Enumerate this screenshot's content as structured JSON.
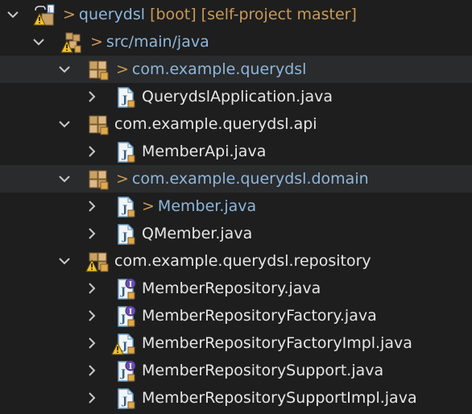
{
  "colors": {
    "background": "#1e1e1e",
    "selected_row": "#2a2b2c",
    "text": "#e6e6e6",
    "changed_text": "#8db7dd",
    "git_decoration": "#c99a57",
    "package_icon": "#c8a165",
    "java_file_icon": "#6da2c9",
    "interface_badge": "#6a4fb4",
    "warning": "#f1c232"
  },
  "tree": {
    "project": {
      "icon": "project-icon-with-warning",
      "prefix": ">",
      "name": "querydsl",
      "decoration": "[boot] [self-project master]"
    },
    "source_folder": {
      "icon": "source-folder-icon-with-warning",
      "prefix": ">",
      "name": "src/main/java"
    },
    "items": [
      {
        "kind": "package",
        "icon": "package-icon",
        "prefix": ">",
        "label": "com.example.querydsl",
        "changed": true,
        "expanded": true
      },
      {
        "kind": "file",
        "icon": "java-class-icon",
        "prefix": "",
        "label": "QuerydslApplication.java",
        "changed": false,
        "expanded": false
      },
      {
        "kind": "package",
        "icon": "package-icon",
        "prefix": "",
        "label": "com.example.querydsl.api",
        "changed": false,
        "expanded": true
      },
      {
        "kind": "file",
        "icon": "java-class-icon",
        "prefix": "",
        "label": "MemberApi.java",
        "changed": false,
        "expanded": false
      },
      {
        "kind": "package",
        "icon": "package-icon",
        "prefix": ">",
        "label": "com.example.querydsl.domain",
        "changed": true,
        "expanded": true
      },
      {
        "kind": "file",
        "icon": "java-class-icon",
        "prefix": ">",
        "label": "Member.java",
        "changed": true,
        "expanded": false
      },
      {
        "kind": "file",
        "icon": "java-class-icon",
        "prefix": "",
        "label": "QMember.java",
        "changed": false,
        "expanded": false
      },
      {
        "kind": "package",
        "icon": "package-icon-with-warning",
        "prefix": "",
        "label": "com.example.querydsl.repository",
        "changed": false,
        "expanded": true
      },
      {
        "kind": "file",
        "icon": "java-interface-icon",
        "prefix": "",
        "label": "MemberRepository.java",
        "changed": false,
        "expanded": false
      },
      {
        "kind": "file",
        "icon": "java-interface-icon",
        "prefix": "",
        "label": "MemberRepositoryFactory.java",
        "changed": false,
        "expanded": false
      },
      {
        "kind": "file",
        "icon": "java-class-icon-with-warning",
        "prefix": "",
        "label": "MemberRepositoryFactoryImpl.java",
        "changed": false,
        "expanded": false
      },
      {
        "kind": "file",
        "icon": "java-interface-icon",
        "prefix": "",
        "label": "MemberRepositorySupport.java",
        "changed": false,
        "expanded": false
      },
      {
        "kind": "file",
        "icon": "java-class-icon",
        "prefix": "",
        "label": "MemberRepositorySupportImpl.java",
        "changed": false,
        "expanded": false
      }
    ]
  }
}
